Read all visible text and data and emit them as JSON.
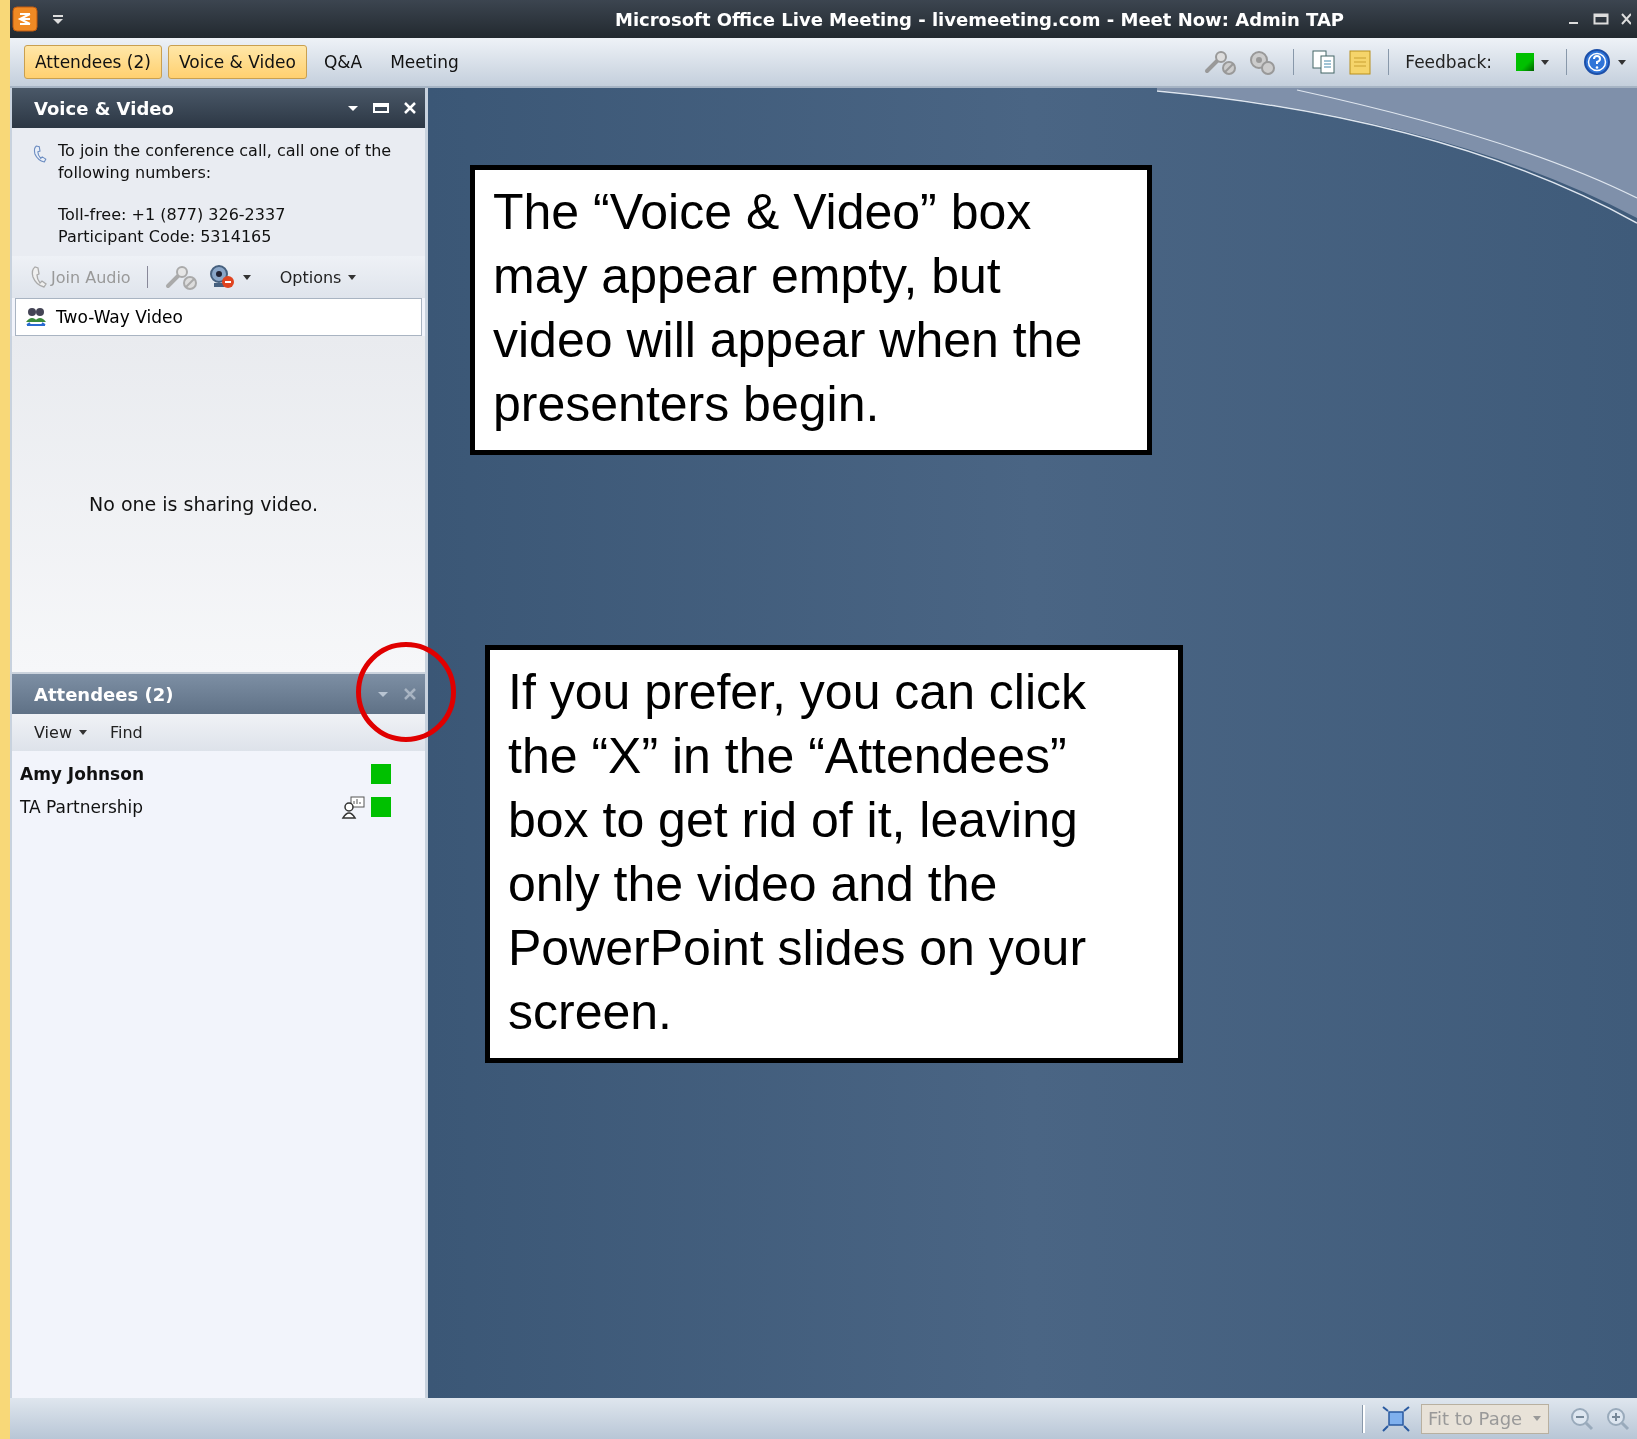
{
  "window": {
    "title": "Microsoft Office Live Meeting - livemeeting.com - Meet Now: Admin TAP"
  },
  "tabs": [
    {
      "label": "Attendees (2)",
      "selected": true
    },
    {
      "label": "Voice & Video",
      "selected": true
    },
    {
      "label": "Q&A",
      "selected": false
    },
    {
      "label": "Meeting",
      "selected": false
    }
  ],
  "toolbar": {
    "feedback_label": "Feedback:"
  },
  "voice_video_panel": {
    "title": "Voice & Video",
    "instructions": "To join the conference call, call one of the following numbers:",
    "toll_free": "Toll-free: +1 (877) 326-2337",
    "participant_code": "Participant Code: 5314165",
    "join_audio": {
      "label": "Join Audio",
      "disabled": true
    },
    "options": "Options",
    "video_mode": "Two-Way Video",
    "empty_message": "No one is sharing video."
  },
  "attendees_panel": {
    "title": "Attendees (2)",
    "view": "View",
    "find": "Find",
    "attendees": [
      {
        "name": "Amy Johnson",
        "is_self": true,
        "presenter_icon": false,
        "color": "#00c000"
      },
      {
        "name": "TA Partnership",
        "is_self": false,
        "presenter_icon": true,
        "color": "#00c000"
      }
    ]
  },
  "callouts": [
    {
      "text": "The “Voice & Video” box may appear empty, but video will appear when the presenters begin."
    },
    {
      "text": "If you prefer, you can click the “X” in the “Attendees” box to get rid of it, leaving only the video and the PowerPoint slides on your screen."
    }
  ],
  "status_bar": {
    "zoom": "Fit to Page"
  }
}
